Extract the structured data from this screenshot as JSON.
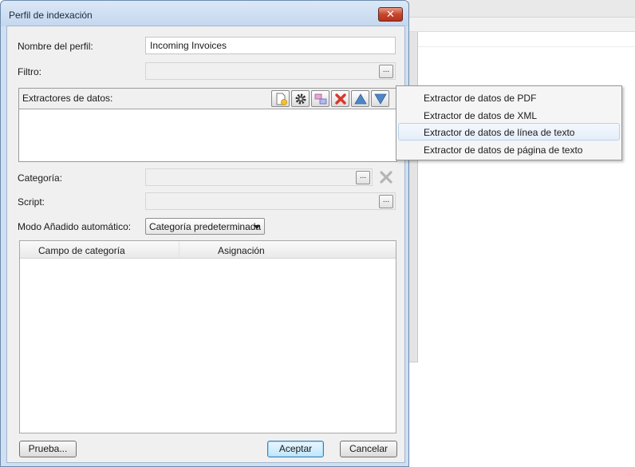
{
  "dialog": {
    "title": "Perfil de indexación",
    "close_icon": "close-icon"
  },
  "profile_name": {
    "label": "Nombre del perfil:",
    "value": "Incoming Invoices"
  },
  "filter": {
    "label": "Filtro:",
    "value": "",
    "browse_label": "..."
  },
  "extractors": {
    "label": "Extractores de datos:",
    "toolbar_icons": [
      "add-extractor-icon",
      "settings-gear-icon",
      "mapping-icon",
      "delete-icon",
      "move-up-icon",
      "move-down-icon"
    ]
  },
  "category": {
    "label": "Categoría:",
    "value": "",
    "browse_label": "..."
  },
  "script": {
    "label": "Script:",
    "value": "",
    "browse_label": "..."
  },
  "auto_add_mode": {
    "label": "Modo Añadido automático:",
    "selected": "Categoría predeterminada"
  },
  "mapping_table": {
    "columns": [
      "Campo de categoría",
      "Asignación"
    ]
  },
  "footer": {
    "test_label": "Prueba...",
    "accept_label": "Aceptar",
    "cancel_label": "Cancelar"
  },
  "extractor_menu": {
    "items": [
      "Extractor de datos de PDF",
      "Extractor de datos de XML",
      "Extractor de datos de línea de texto",
      "Extractor de datos de página de texto"
    ],
    "hovered_index": 2
  },
  "colors": {
    "window_frame": "#cfe0f2",
    "close_button": "#c8452d",
    "menu_hover": "#e4eef9",
    "delete_red": "#d9372b",
    "arrow_blue": "#4f86c6"
  }
}
